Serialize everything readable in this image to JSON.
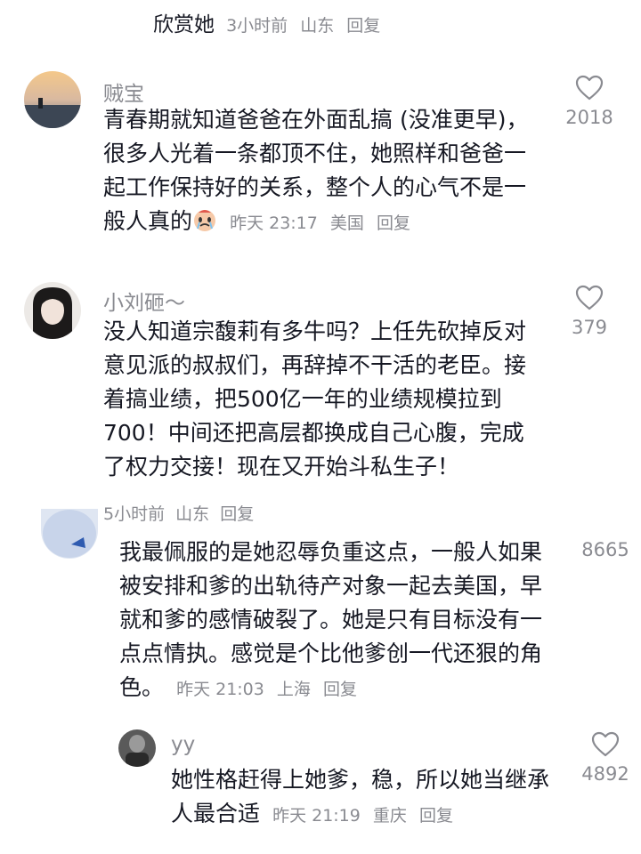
{
  "top": {
    "nickname": "欣赏她",
    "time": "3小时前",
    "location": "山东",
    "reply": "回复"
  },
  "comments": [
    {
      "username": "贼宝",
      "text": "青春期就知道爸爸在外面乱搞 (没准更早)，很多人光着一条都顶不住，她照样和爸爸一起工作保持好的关系，整个人的心气不是一般人真的",
      "time": "昨天 23:17",
      "location": "美国",
      "reply": "回复",
      "likes": "2018"
    },
    {
      "username": "小刘砸～",
      "text": "没人知道宗馥莉有多牛吗？上任先砍掉反对意见派的叔叔们，再辞掉不干活的老臣。接着搞业绩，把500亿一年的业绩规模拉到700！中间还把高层都换成自己心腹，完成了权力交接！现在又开始斗私生子！",
      "time": "5小时前",
      "location": "山东",
      "reply": "回复",
      "likes": "379"
    },
    {
      "username": "",
      "text": "我最佩服的是她忍辱负重这点，一般人如果被安排和爹的出轨待产对象一起去美国，早就和爹的感情破裂了。她是只有目标没有一点点情执。感觉是个比他爹创一代还狠的角色。",
      "time": "昨天 21:03",
      "location": "上海",
      "reply": "回复",
      "likes": "8665"
    },
    {
      "username": "yy",
      "text": "她性格赶得上她爹，稳，所以她当继承人最合适",
      "time": "昨天 21:19",
      "location": "重庆",
      "reply": "回复",
      "likes": "4892"
    }
  ],
  "icons": {
    "like": "heart-outline-icon",
    "emoji": "crying-face-emoji"
  },
  "colors": {
    "text": "#161823",
    "meta": "#8a8b91"
  }
}
